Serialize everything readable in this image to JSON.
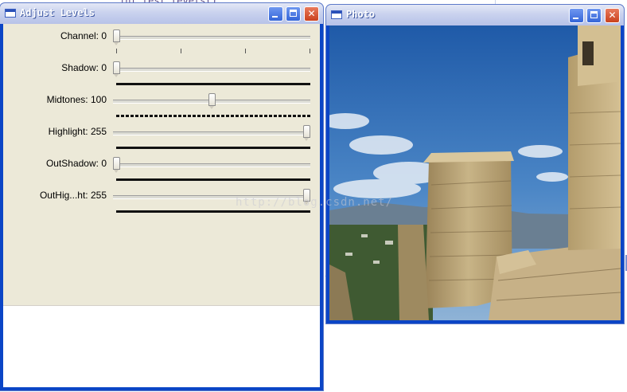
{
  "background_editor": {
    "code_snippet": "int test_levels()"
  },
  "levels_window": {
    "title": "Adjust Levels",
    "trackbars": [
      {
        "label": "Channel: 0",
        "value": 0,
        "max": 3,
        "bar": "ticks"
      },
      {
        "label": "Shadow: 0",
        "value": 0,
        "max": 255,
        "bar": "solid"
      },
      {
        "label": "Midtones: 100",
        "value": 100,
        "max": 200,
        "bar": "dashed"
      },
      {
        "label": "Highlight: 255",
        "value": 255,
        "max": 255,
        "bar": "solid"
      },
      {
        "label": "OutShadow: 0",
        "value": 0,
        "max": 255,
        "bar": "solid"
      },
      {
        "label": "OutHig...ht: 255",
        "value": 255,
        "max": 255,
        "bar": "solid"
      }
    ]
  },
  "photo_window": {
    "title": "Photo"
  },
  "watermark": "http://blog.csdn.net/",
  "colors": {
    "titlebar_start": "#e4e8f6",
    "window_border": "#0b45c6",
    "close_button": "#c9411e",
    "client_bg": "#ece9d8"
  }
}
